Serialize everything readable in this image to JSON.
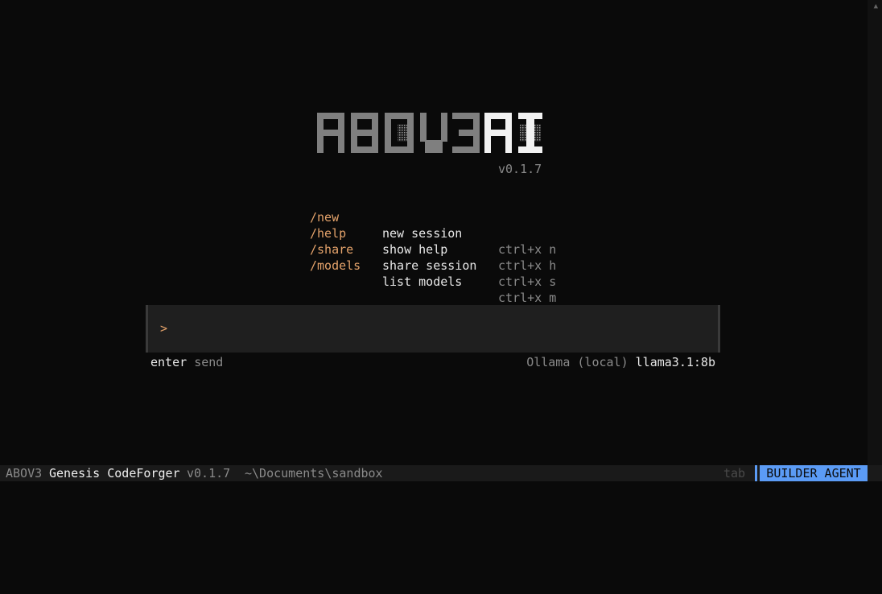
{
  "logo": {
    "text": "ABOV3 AI",
    "version": "v0.1.7"
  },
  "commands": [
    {
      "name": "/new",
      "description": "new session",
      "shortcut": "ctrl+x n"
    },
    {
      "name": "/help",
      "description": "show help",
      "shortcut": "ctrl+x h"
    },
    {
      "name": "/share",
      "description": "share session",
      "shortcut": "ctrl+x s"
    },
    {
      "name": "/models",
      "description": "list models",
      "shortcut": "ctrl+x m"
    }
  ],
  "prompt": {
    "caret": ">",
    "value": ""
  },
  "hints": {
    "enter_key": "enter",
    "enter_action": "send",
    "provider": "Ollama (local)",
    "model": "llama3.1:8b"
  },
  "statusbar": {
    "app_prefix": "ABOV3",
    "app_name": "Genesis CodeForger",
    "version": "v0.1.7",
    "path": "~\\Documents\\sandbox",
    "tab_hint": "tab",
    "agent": "BUILDER AGENT"
  },
  "colors": {
    "background": "#0a0a0a",
    "accent_orange": "#e5a36b",
    "agent_blue": "#5b9bf5",
    "logo_grey": "#7f7f7f",
    "logo_white": "#f2f2f2"
  }
}
